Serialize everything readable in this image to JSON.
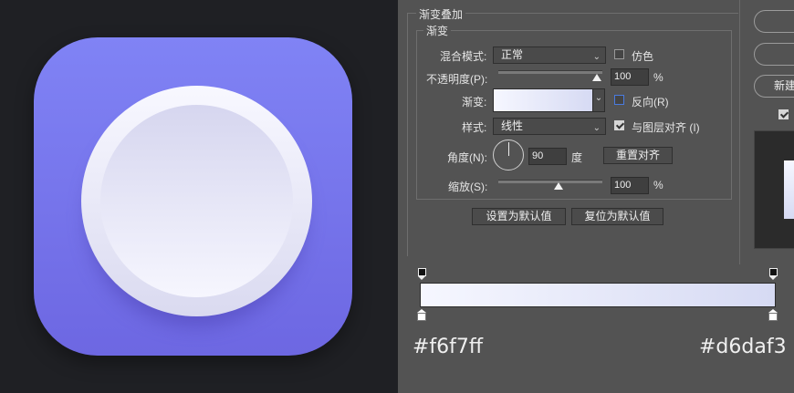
{
  "layer_style": {
    "section_title": "渐变叠加",
    "group_title": "渐变",
    "blend_mode": {
      "label": "混合模式:",
      "value": "正常"
    },
    "dither": {
      "label": "仿色",
      "checked": false
    },
    "opacity": {
      "label": "不透明度(P):",
      "value": "100",
      "unit": "%",
      "level": 1.0
    },
    "gradient": {
      "label": "渐变:",
      "start_color": "#f6f7ff",
      "end_color": "#d6daf3"
    },
    "reverse": {
      "label": "反向(R)",
      "checked": false
    },
    "style": {
      "label": "样式:",
      "value": "线性"
    },
    "align_with_layer": {
      "label": "与图层对齐 (I)",
      "checked": true
    },
    "angle": {
      "label": "角度(N):",
      "value": "90",
      "unit": "度",
      "reset_label": "重置对齐"
    },
    "scale": {
      "label": "缩放(S):",
      "value": "100",
      "unit": "%",
      "level": 0.5
    },
    "buttons": {
      "make_default": "设置为默认值",
      "reset_default": "复位为默认值"
    }
  },
  "right_column": {
    "new_style_label": "新建",
    "preview_checked": true
  },
  "gradient_editor": {
    "start_hex": "#f6f7ff",
    "end_hex": "#d6daf3",
    "start_color": "#f6f7ff",
    "end_color": "#d6daf3"
  },
  "icon_preview": {
    "tile_top_color": "#8083f5",
    "tile_bottom_color": "#6d67e2"
  }
}
